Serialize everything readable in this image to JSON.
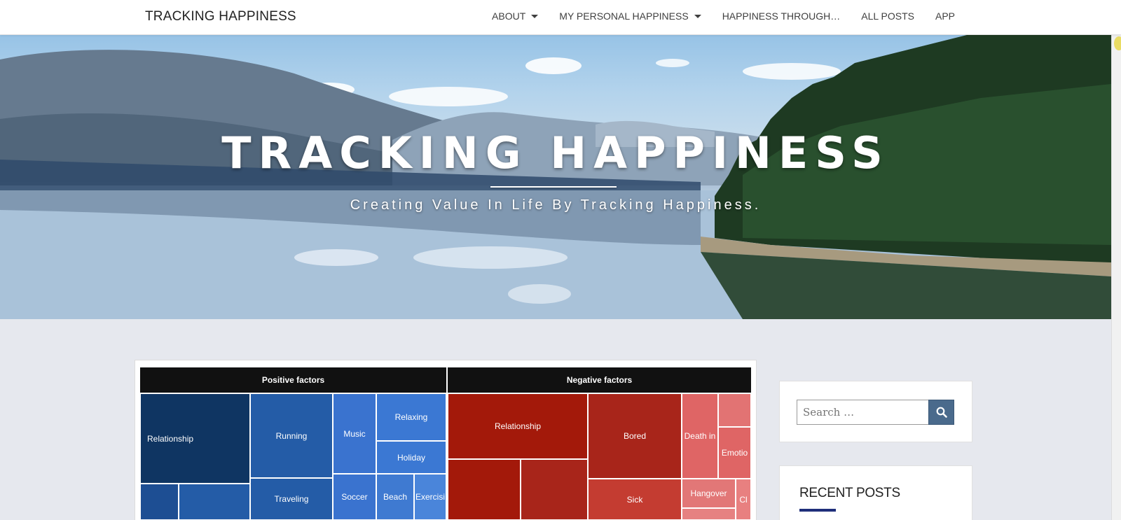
{
  "navbar": {
    "brand": "TRACKING HAPPINESS",
    "items": [
      {
        "label": "ABOUT",
        "has_dropdown": true
      },
      {
        "label": "MY PERSONAL HAPPINESS",
        "has_dropdown": true
      },
      {
        "label": "HAPPINESS THROUGH…",
        "has_dropdown": false
      },
      {
        "label": "ALL POSTS",
        "has_dropdown": false
      },
      {
        "label": "APP",
        "has_dropdown": false
      }
    ]
  },
  "hero": {
    "title": "TRACKING HAPPINESS",
    "subtitle": "Creating Value In Life By Tracking Happiness."
  },
  "treemap": {
    "positive_header": "Positive factors",
    "negative_header": "Negative factors",
    "positive": [
      "Relationship",
      "Running",
      "Music",
      "Relaxing",
      "Holiday",
      "Traveling",
      "Soccer",
      "Beach",
      "Exercisi"
    ],
    "negative": [
      "Relationship",
      "Bored",
      "Death in",
      "Emotio",
      "Sick",
      "Hangover",
      "Cl"
    ],
    "colors": {
      "positive_dark": "#0f3562",
      "positive_mid": "#2a5da8",
      "positive_light": "#3f7ad1",
      "negative_dark": "#a3190a",
      "negative_mid": "#c0392b",
      "negative_light": "#df6565"
    }
  },
  "sidebar": {
    "search_placeholder": "Search …",
    "recent_title": "RECENT POSTS"
  }
}
